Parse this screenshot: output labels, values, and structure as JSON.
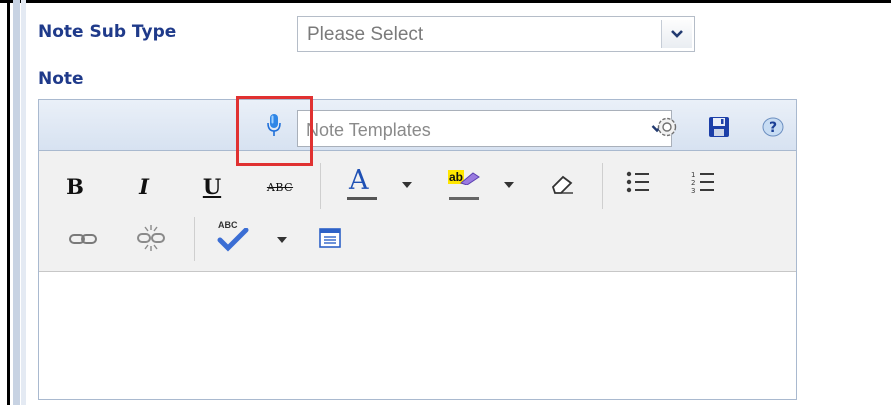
{
  "form": {
    "note_sub_type_label": "Note Sub Type",
    "note_sub_type_value": "Please Select",
    "note_label": "Note"
  },
  "editor": {
    "templates_placeholder": "Note Templates",
    "header_icons": [
      "microphone-icon",
      "settings-icon",
      "save-icon",
      "help-icon"
    ],
    "toolbar_row1": [
      "bold",
      "italic",
      "underline",
      "strikethrough",
      "font-color",
      "highlight-color",
      "eraser",
      "bulleted-list",
      "numbered-list"
    ],
    "toolbar_row2": [
      "link",
      "unlink",
      "spellcheck",
      "source"
    ],
    "bold_label": "B",
    "italic_label": "I",
    "underline_label": "U",
    "strike_label": "ABC",
    "font_color_label": "A",
    "highlight_label": "ab",
    "spell_label": "ABC"
  },
  "colors": {
    "label_blue": "#1f3a8a",
    "highlight_box": "#e03131",
    "mic_blue": "#1e6fd9"
  }
}
